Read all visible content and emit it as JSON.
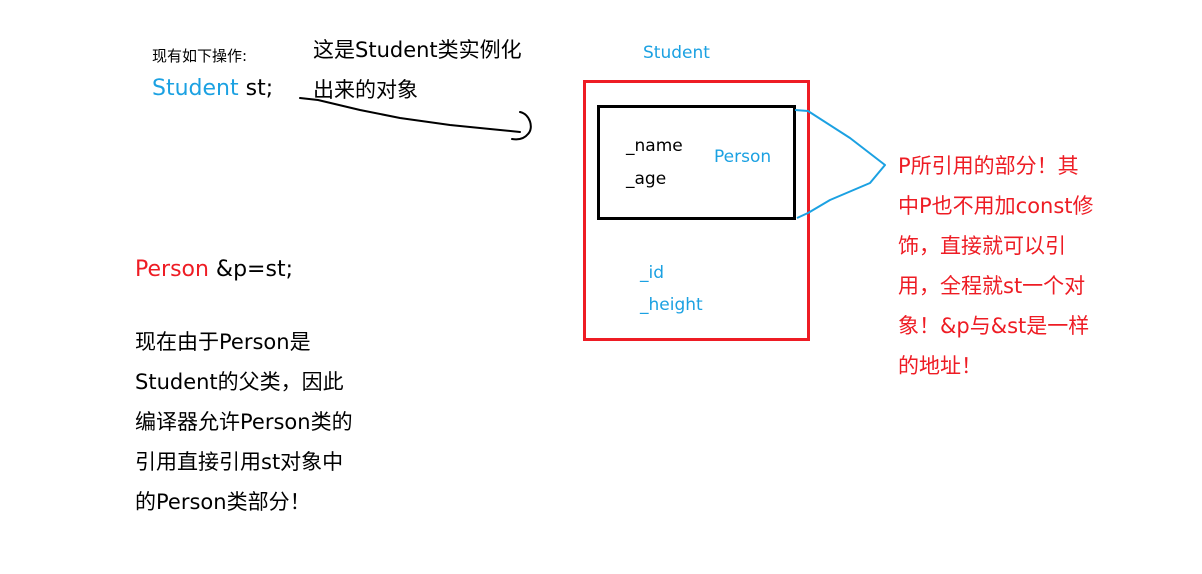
{
  "colors": {
    "accent_blue": "#1ba1e2",
    "accent_red": "#ee1c24",
    "text": "#000000"
  },
  "top_note": {
    "label": "现有如下操作:",
    "code_type": "Student",
    "code_rest": " st;"
  },
  "instance_caption": {
    "lines": [
      "这是Student类实例化",
      "出来的对象"
    ]
  },
  "object_diagram": {
    "outer_label": "Student",
    "inner_label": "Person",
    "inner_fields": [
      "_name",
      "_age"
    ],
    "outer_fields": [
      "_id",
      "_height"
    ]
  },
  "reference_code": {
    "type": "Person",
    "rest": " &p=st;"
  },
  "explanation": {
    "lines": [
      "现在由于Person是",
      "Student的父类，因此",
      "编译器允许Person类的",
      "引用直接引用st对象中",
      "的Person类部分！"
    ]
  },
  "right_note": {
    "lines": [
      "P所引用的部分！其",
      "中P也不用加const修",
      "饰，直接就可以引",
      "用，全程就st一个对",
      "象！&p与&st是一样",
      "的地址！"
    ]
  }
}
